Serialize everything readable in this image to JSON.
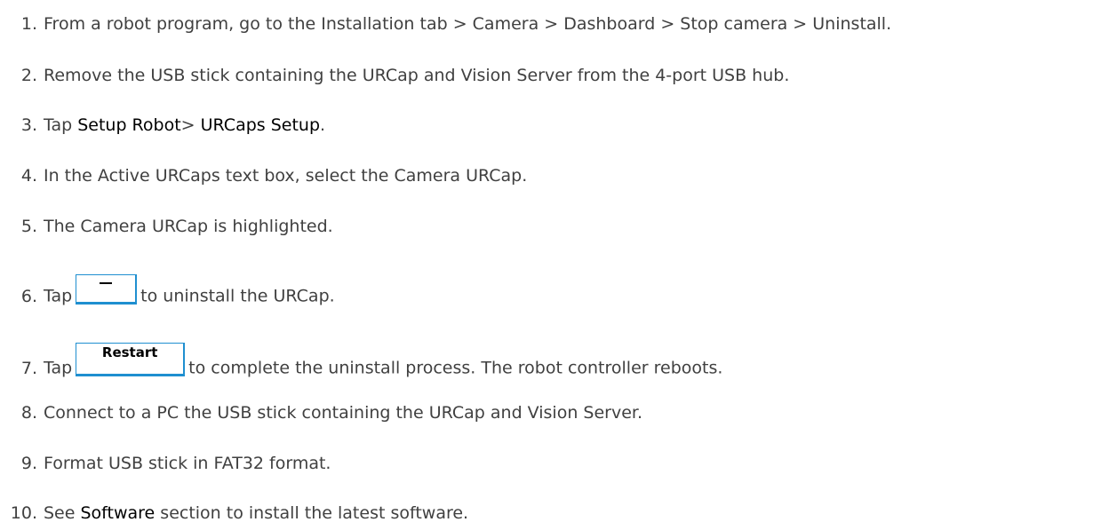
{
  "steps": [
    {
      "num": "1.",
      "text": "From a robot program, go to the Installation tab > Camera > Dashboard > Stop camera > Uninstall."
    },
    {
      "num": "2.",
      "text": "Remove the USB stick containing the URCap and Vision Server from the 4-port USB hub."
    },
    {
      "num": "3.",
      "pre": "Tap ",
      "link1": "Setup Robot",
      "mid": "> ",
      "link2": "URCaps Setup",
      "post": "."
    },
    {
      "num": "4.",
      "text": "In the Active URCaps text box, select the Camera URCap."
    },
    {
      "num": "5.",
      "text": "The Camera URCap is highlighted."
    },
    {
      "num": "6.",
      "pre": "Tap",
      "post": "to uninstall the URCap.",
      "button_icon": "minus-icon"
    },
    {
      "num": "7.",
      "pre": "Tap",
      "button_label": "Restart",
      "post": "to complete the uninstall process. The robot controller reboots."
    },
    {
      "num": "8.",
      "text": "Connect to a PC the USB stick containing the URCap and Vision Server."
    },
    {
      "num": "9.",
      "text": "Format USB stick in FAT32 format."
    },
    {
      "num": "10.",
      "pre": "See ",
      "link": "Software",
      "post": " section to install the latest software."
    }
  ],
  "colors": {
    "text": "#404040",
    "highlight_text": "#000000",
    "button_border": "#1f8fd0"
  }
}
